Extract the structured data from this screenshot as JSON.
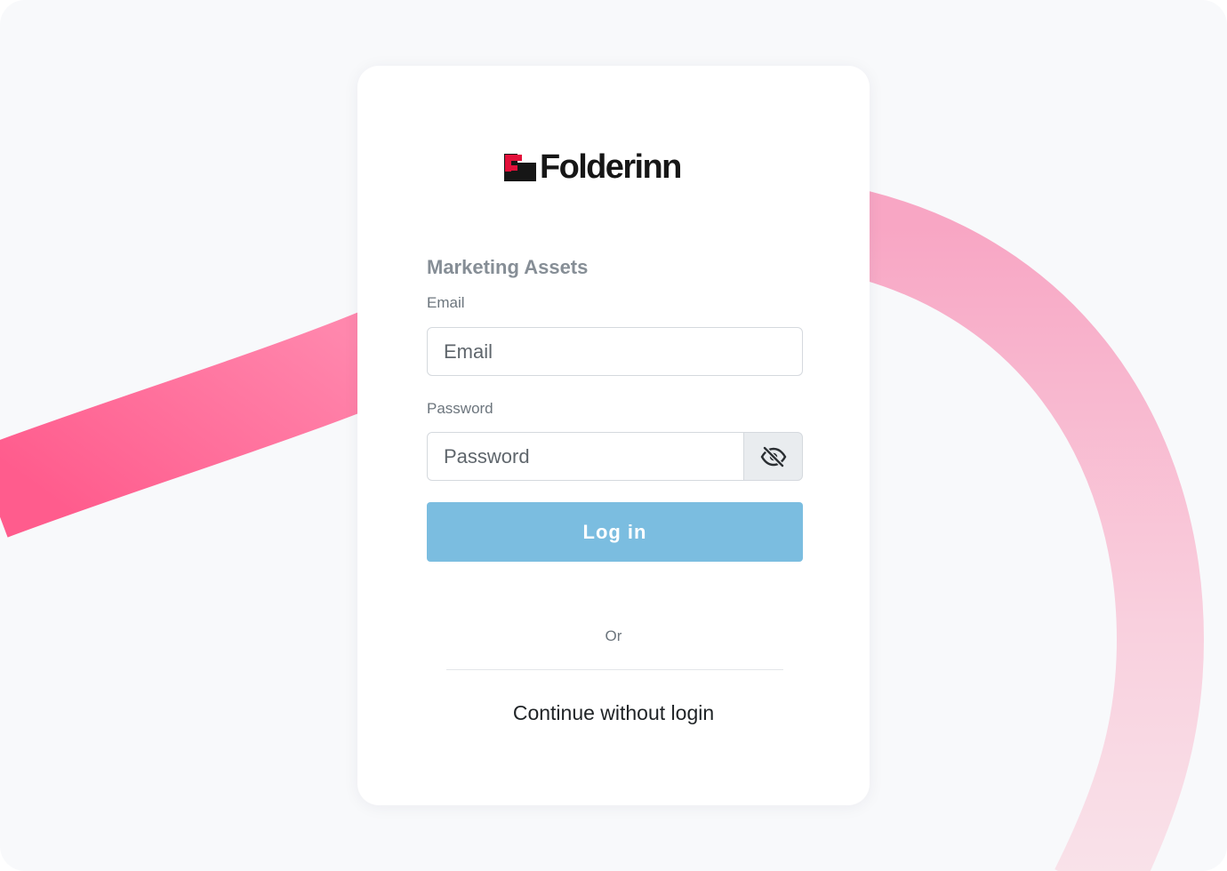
{
  "brand": {
    "name": "Folderinn",
    "logo_icon": "folderinn-logo-icon",
    "logo_mark_color": "#e3103a",
    "logo_text_color": "#161616"
  },
  "login_form": {
    "title": "Marketing Assets",
    "email": {
      "label": "Email",
      "placeholder": "Email",
      "value": ""
    },
    "password": {
      "label": "Password",
      "placeholder": "Password",
      "value": "",
      "visibility_toggle_icon": "eye-slash-icon"
    },
    "login_button_label": "Log in",
    "separator_text": "Or",
    "continue_label": "Continue without login"
  },
  "colors": {
    "login_button": "#7bbde0",
    "background": "#f8f9fb",
    "accent_swoosh": "#ff5c8d"
  }
}
